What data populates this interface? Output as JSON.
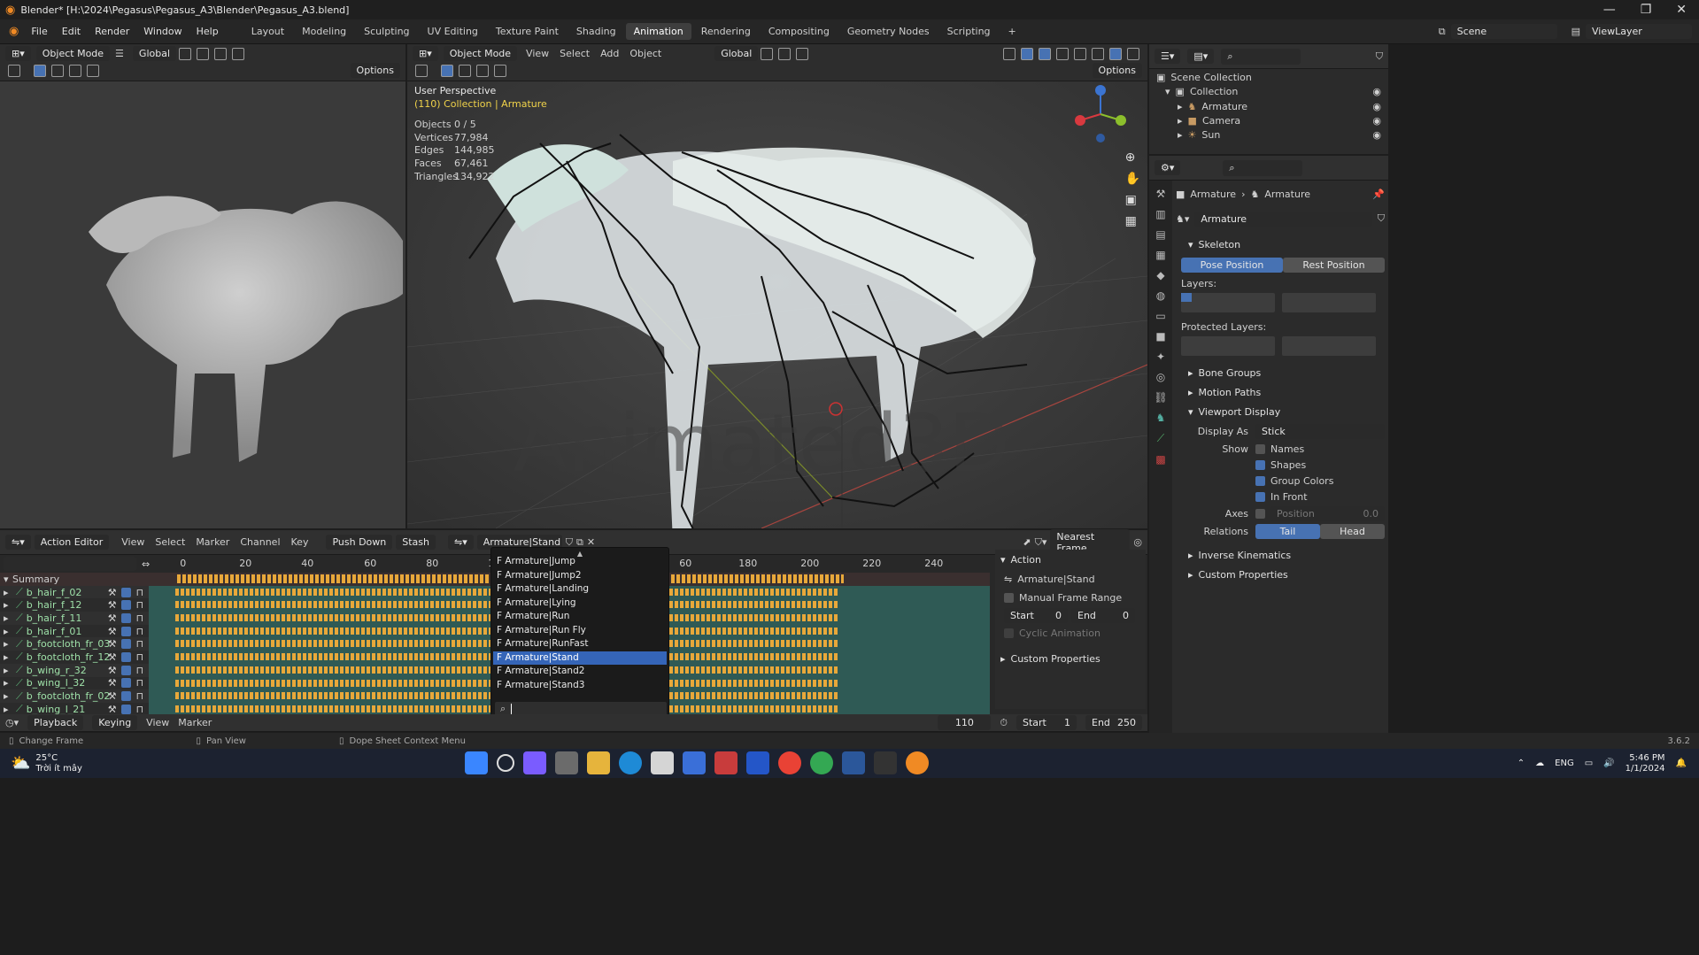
{
  "window": {
    "title": "Blender* [H:\\2024\\Pegasus\\Pegasus_A3\\Blender\\Pegasus_A3.blend]"
  },
  "menu": [
    "File",
    "Edit",
    "Render",
    "Window",
    "Help"
  ],
  "workspaces": [
    {
      "label": "Layout"
    },
    {
      "label": "Modeling"
    },
    {
      "label": "Sculpting"
    },
    {
      "label": "UV Editing"
    },
    {
      "label": "Texture Paint"
    },
    {
      "label": "Shading"
    },
    {
      "label": "Animation",
      "active": true
    },
    {
      "label": "Rendering"
    },
    {
      "label": "Compositing"
    },
    {
      "label": "Geometry Nodes"
    },
    {
      "label": "Scripting"
    }
  ],
  "scene": {
    "name": "Scene",
    "view_layer": "ViewLayer"
  },
  "left_viewport": {
    "mode": "Object Mode",
    "orientation": "Global",
    "options": "Options"
  },
  "main_viewport": {
    "mode": "Object Mode",
    "menu": [
      "View",
      "Select",
      "Add",
      "Object"
    ],
    "orientation": "Global",
    "options": "Options",
    "perspective": "User Perspective",
    "collection": "(110) Collection | Armature",
    "stats": [
      {
        "label": "Objects",
        "value": "0 / 5"
      },
      {
        "label": "Vertices",
        "value": "77,984"
      },
      {
        "label": "Edges",
        "value": "144,985"
      },
      {
        "label": "Faces",
        "value": "67,461"
      },
      {
        "label": "Triangles",
        "value": "134,922"
      }
    ],
    "watermark": "Animated3D"
  },
  "outliner": {
    "root": "Scene Collection",
    "collection": "Collection",
    "items": [
      {
        "label": "Armature"
      },
      {
        "label": "Camera"
      },
      {
        "label": "Sun"
      }
    ]
  },
  "properties": {
    "breadcrumb": [
      "Armature",
      "Armature"
    ],
    "data_name": "Armature",
    "skeleton": "Skeleton",
    "pose_position": "Pose Position",
    "rest_position": "Rest Position",
    "layers_label": "Layers:",
    "protected_layers_label": "Protected Layers:",
    "bone_groups": "Bone Groups",
    "motion_paths": "Motion Paths",
    "viewport_display": "Viewport Display",
    "display_as_label": "Display As",
    "display_as_value": "Stick",
    "show_label": "Show",
    "show_opts": [
      {
        "label": "Names",
        "checked": false
      },
      {
        "label": "Shapes",
        "checked": true
      },
      {
        "label": "Group Colors",
        "checked": true
      },
      {
        "label": "In Front",
        "checked": true
      }
    ],
    "axes_label": "Axes",
    "position_label": "Position",
    "position_value": "0.0",
    "relations_label": "Relations",
    "tail": "Tail",
    "head": "Head",
    "inverse_kinematics": "Inverse Kinematics",
    "custom_properties": "Custom Properties"
  },
  "action_editor": {
    "mode": "Action Editor",
    "menu": [
      "View",
      "Select",
      "Marker",
      "Channel",
      "Key"
    ],
    "push_down": "Push Down",
    "stash": "Stash",
    "action": "Armature|Stand",
    "snap": "Nearest Frame",
    "ruler": [
      "0",
      "20",
      "40",
      "60",
      "80",
      "10",
      "60",
      "180",
      "200",
      "220",
      "240"
    ],
    "summary": "Summary",
    "channels": [
      "b_hair_f_02",
      "b_hair_f_12",
      "b_hair_f_11",
      "b_hair_f_01",
      "b_footcloth_fr_03",
      "b_footcloth_fr_12",
      "b_wing_r_32",
      "b_wing_l_32",
      "b_footcloth_fr_02",
      "b_wing_l_21"
    ]
  },
  "action_dropdown": {
    "items": [
      {
        "label": "F Armature|Jump"
      },
      {
        "label": "F Armature|Jump2"
      },
      {
        "label": "F Armature|Landing"
      },
      {
        "label": "F Armature|Lying"
      },
      {
        "label": "F Armature|Run"
      },
      {
        "label": "F Armature|Run Fly"
      },
      {
        "label": "F Armature|RunFast"
      },
      {
        "label": "F Armature|Stand",
        "selected": true
      },
      {
        "label": "F Armature|Stand2"
      },
      {
        "label": "F Armature|Stand3"
      }
    ]
  },
  "action_panel": {
    "title": "Action",
    "action_name": "Armature|Stand",
    "manual_frame_range": "Manual Frame Range",
    "start_label": "Start",
    "start_value": "0",
    "end_label": "End",
    "end_value": "0",
    "cyclic": "Cyclic Animation",
    "custom_properties": "Custom Properties"
  },
  "timeline": {
    "menu": [
      "Playback",
      "Keying",
      "View",
      "Marker"
    ],
    "current_frame": "110",
    "start_label": "Start",
    "start": "1",
    "end_label": "End",
    "end": "250"
  },
  "statusbar": {
    "items": [
      "Change Frame",
      "Pan View",
      "Dope Sheet Context Menu"
    ],
    "version": "3.6.2"
  },
  "taskbar": {
    "temp": "25°C",
    "weather": "Trời ít mây",
    "lang": "ENG",
    "time": "5:46 PM",
    "date": "1/1/2024"
  },
  "colors": {
    "accent": "#4772b3",
    "selected": "#3565b8",
    "track": "#2f5a55",
    "keyframe": "#e8a83a"
  }
}
